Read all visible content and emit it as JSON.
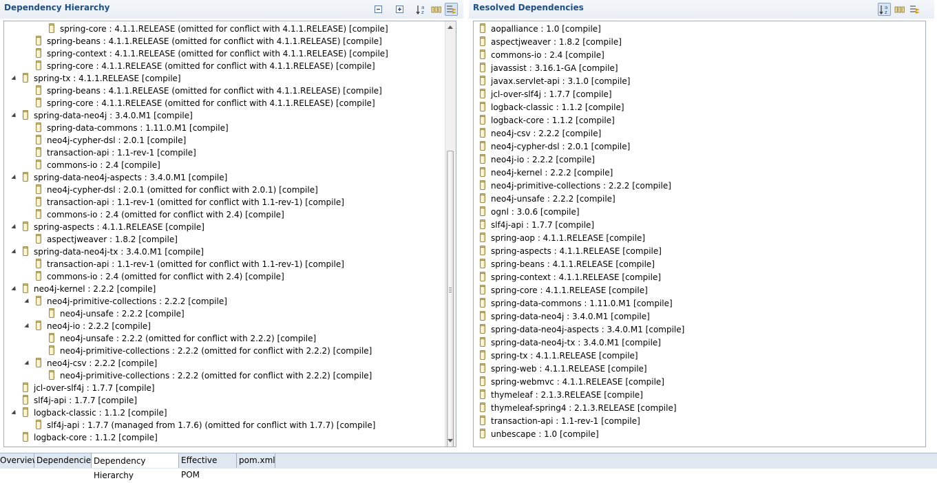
{
  "left_panel": {
    "title": "Dependency Hierarchy",
    "toolbar": [
      {
        "icon": "collapse-all-icon",
        "pressed": false
      },
      {
        "icon": "expand-all-icon",
        "pressed": false
      },
      {
        "icon": "sort-alphabetical-icon",
        "pressed": false
      },
      {
        "icon": "show-group-id-icon",
        "pressed": false
      },
      {
        "icon": "filter-icon",
        "pressed": true
      }
    ],
    "rows": [
      {
        "level": 3,
        "expanded": false,
        "text": "spring-core : 4.1.1.RELEASE (omitted for conflict with 4.1.1.RELEASE) [compile]"
      },
      {
        "level": 2,
        "expanded": false,
        "text": "spring-beans : 4.1.1.RELEASE (omitted for conflict with 4.1.1.RELEASE) [compile]"
      },
      {
        "level": 2,
        "expanded": false,
        "text": "spring-context : 4.1.1.RELEASE (omitted for conflict with 4.1.1.RELEASE) [compile]"
      },
      {
        "level": 2,
        "expanded": false,
        "text": "spring-core : 4.1.1.RELEASE (omitted for conflict with 4.1.1.RELEASE) [compile]"
      },
      {
        "level": 1,
        "expanded": true,
        "text": "spring-tx : 4.1.1.RELEASE [compile]"
      },
      {
        "level": 2,
        "expanded": false,
        "text": "spring-beans : 4.1.1.RELEASE (omitted for conflict with 4.1.1.RELEASE) [compile]"
      },
      {
        "level": 2,
        "expanded": false,
        "text": "spring-core : 4.1.1.RELEASE (omitted for conflict with 4.1.1.RELEASE) [compile]"
      },
      {
        "level": 1,
        "expanded": true,
        "text": "spring-data-neo4j : 3.4.0.M1 [compile]"
      },
      {
        "level": 2,
        "expanded": false,
        "text": "spring-data-commons : 1.11.0.M1 [compile]"
      },
      {
        "level": 2,
        "expanded": false,
        "text": "neo4j-cypher-dsl : 2.0.1 [compile]"
      },
      {
        "level": 2,
        "expanded": false,
        "text": "transaction-api : 1.1-rev-1 [compile]"
      },
      {
        "level": 2,
        "expanded": false,
        "text": "commons-io : 2.4 [compile]"
      },
      {
        "level": 1,
        "expanded": true,
        "text": "spring-data-neo4j-aspects : 3.4.0.M1 [compile]"
      },
      {
        "level": 2,
        "expanded": false,
        "text": "neo4j-cypher-dsl : 2.0.1 (omitted for conflict with 2.0.1) [compile]"
      },
      {
        "level": 2,
        "expanded": false,
        "text": "transaction-api : 1.1-rev-1 (omitted for conflict with 1.1-rev-1) [compile]"
      },
      {
        "level": 2,
        "expanded": false,
        "text": "commons-io : 2.4 (omitted for conflict with 2.4) [compile]"
      },
      {
        "level": 1,
        "expanded": true,
        "text": "spring-aspects : 4.1.1.RELEASE [compile]"
      },
      {
        "level": 2,
        "expanded": false,
        "text": "aspectjweaver : 1.8.2 [compile]"
      },
      {
        "level": 1,
        "expanded": true,
        "text": "spring-data-neo4j-tx : 3.4.0.M1 [compile]"
      },
      {
        "level": 2,
        "expanded": false,
        "text": "transaction-api : 1.1-rev-1 (omitted for conflict with 1.1-rev-1) [compile]"
      },
      {
        "level": 2,
        "expanded": false,
        "text": "commons-io : 2.4 (omitted for conflict with 2.4) [compile]"
      },
      {
        "level": 1,
        "expanded": true,
        "text": "neo4j-kernel : 2.2.2 [compile]"
      },
      {
        "level": 2,
        "expanded": true,
        "text": "neo4j-primitive-collections : 2.2.2 [compile]"
      },
      {
        "level": 3,
        "expanded": false,
        "text": "neo4j-unsafe : 2.2.2 [compile]"
      },
      {
        "level": 2,
        "expanded": true,
        "text": "neo4j-io : 2.2.2 [compile]"
      },
      {
        "level": 3,
        "expanded": false,
        "text": "neo4j-unsafe : 2.2.2 (omitted for conflict with 2.2.2) [compile]"
      },
      {
        "level": 3,
        "expanded": false,
        "text": "neo4j-primitive-collections : 2.2.2 (omitted for conflict with 2.2.2) [compile]"
      },
      {
        "level": 2,
        "expanded": true,
        "text": "neo4j-csv : 2.2.2 [compile]"
      },
      {
        "level": 3,
        "expanded": false,
        "text": "neo4j-primitive-collections : 2.2.2 (omitted for conflict with 2.2.2) [compile]"
      },
      {
        "level": 1,
        "expanded": false,
        "text": "jcl-over-slf4j : 1.7.7 [compile]"
      },
      {
        "level": 1,
        "expanded": false,
        "text": "slf4j-api : 1.7.7 [compile]"
      },
      {
        "level": 1,
        "expanded": true,
        "text": "logback-classic : 1.1.2 [compile]"
      },
      {
        "level": 2,
        "expanded": false,
        "text": "slf4j-api : 1.7.7 (managed from 1.7.6) (omitted for conflict with 1.7.7) [compile]"
      },
      {
        "level": 1,
        "expanded": false,
        "text": "logback-core : 1.1.2 [compile]"
      }
    ]
  },
  "right_panel": {
    "title": "Resolved Dependencies",
    "toolbar": [
      {
        "icon": "sort-alphabetical-icon",
        "pressed": true
      },
      {
        "icon": "show-group-id-icon",
        "pressed": false
      },
      {
        "icon": "filter-icon",
        "pressed": false
      }
    ],
    "items": [
      "aopalliance : 1.0 [compile]",
      "aspectjweaver : 1.8.2 [compile]",
      "commons-io : 2.4 [compile]",
      "javassist : 3.16.1-GA [compile]",
      "javax.servlet-api : 3.1.0 [compile]",
      "jcl-over-slf4j : 1.7.7 [compile]",
      "logback-classic : 1.1.2 [compile]",
      "logback-core : 1.1.2 [compile]",
      "neo4j-csv : 2.2.2 [compile]",
      "neo4j-cypher-dsl : 2.0.1 [compile]",
      "neo4j-io : 2.2.2 [compile]",
      "neo4j-kernel : 2.2.2 [compile]",
      "neo4j-primitive-collections : 2.2.2 [compile]",
      "neo4j-unsafe : 2.2.2 [compile]",
      "ognl : 3.0.6 [compile]",
      "slf4j-api : 1.7.7 [compile]",
      "spring-aop : 4.1.1.RELEASE [compile]",
      "spring-aspects : 4.1.1.RELEASE [compile]",
      "spring-beans : 4.1.1.RELEASE [compile]",
      "spring-context : 4.1.1.RELEASE [compile]",
      "spring-core : 4.1.1.RELEASE [compile]",
      "spring-data-commons : 1.11.0.M1 [compile]",
      "spring-data-neo4j : 3.4.0.M1 [compile]",
      "spring-data-neo4j-aspects : 3.4.0.M1 [compile]",
      "spring-data-neo4j-tx : 3.4.0.M1 [compile]",
      "spring-tx : 4.1.1.RELEASE [compile]",
      "spring-web : 4.1.1.RELEASE [compile]",
      "spring-webmvc : 4.1.1.RELEASE [compile]",
      "thymeleaf : 2.1.3.RELEASE [compile]",
      "thymeleaf-spring4 : 2.1.3.RELEASE [compile]",
      "transaction-api : 1.1-rev-1 [compile]",
      "unbescape : 1.0 [compile]"
    ]
  },
  "tabs": [
    {
      "label": "Overview",
      "active": false
    },
    {
      "label": "Dependencies",
      "active": false
    },
    {
      "label": "Dependency Hierarchy",
      "active": true
    },
    {
      "label": "Effective POM",
      "active": false
    },
    {
      "label": "pom.xml",
      "active": false
    }
  ]
}
